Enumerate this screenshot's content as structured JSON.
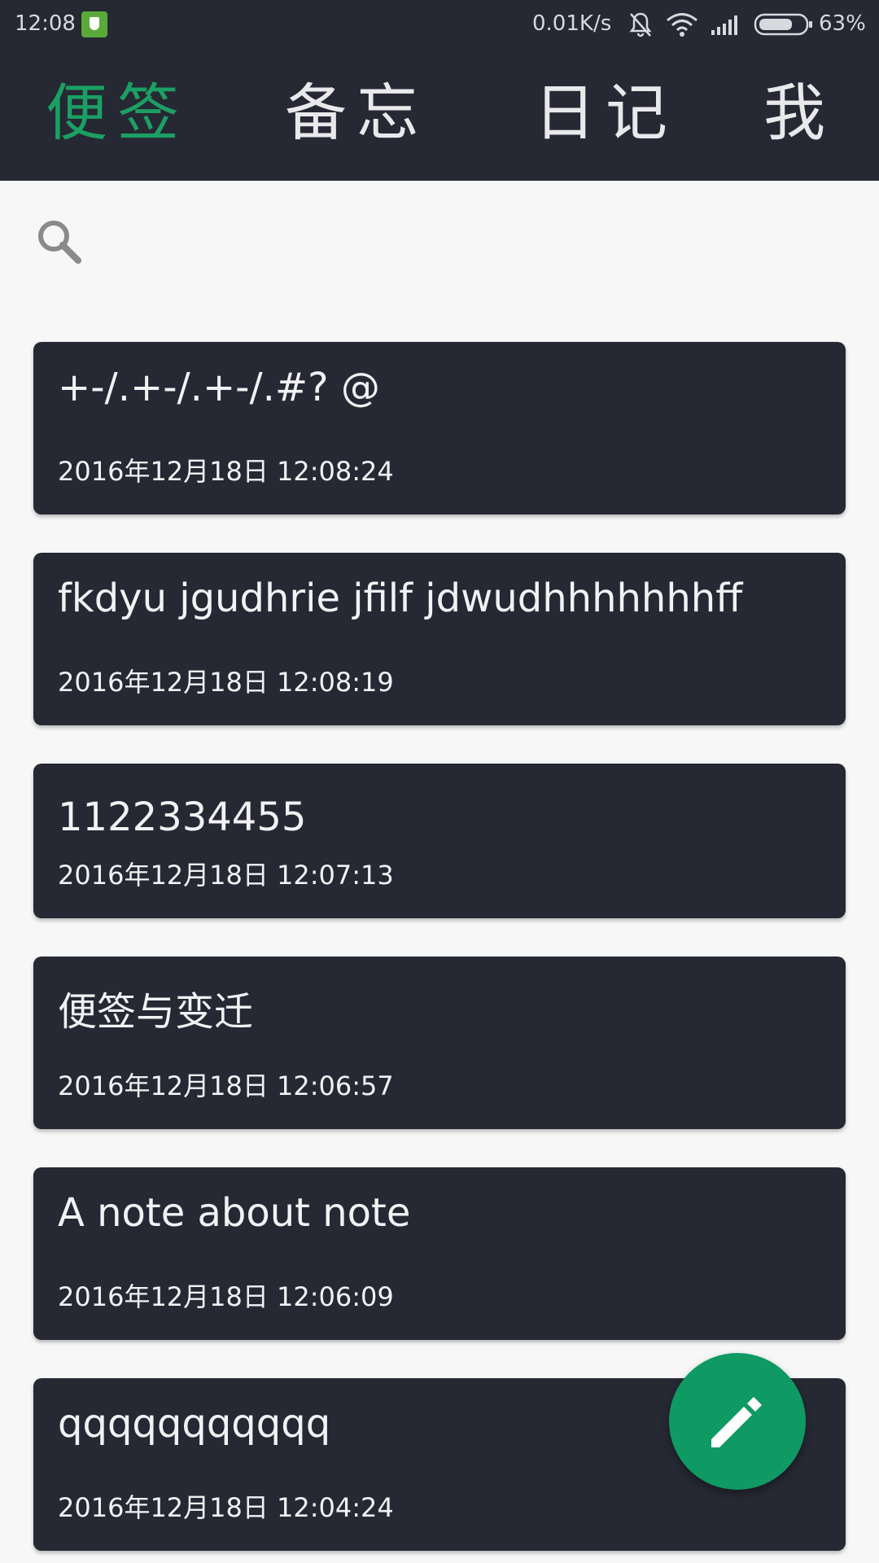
{
  "status_bar": {
    "time": "12:08",
    "network_speed": "0.01K/s",
    "battery_percent": "63%",
    "icons": [
      "shield-app-icon",
      "mute-bell-icon",
      "wifi-icon",
      "signal-icon",
      "battery-icon"
    ]
  },
  "nav": {
    "tabs": [
      {
        "label": "便签",
        "active": true
      },
      {
        "label": "备忘",
        "active": false
      },
      {
        "label": "日记",
        "active": false
      },
      {
        "label": "我",
        "active": false
      }
    ]
  },
  "search": {
    "icon": "search-icon"
  },
  "notes": [
    {
      "title": "+-/.+-/.+-/.#? @",
      "date": "2016年12月18日 12:08:24"
    },
    {
      "title": "fkdyu jgudhrie jfilf jdwudhhhhhhhff",
      "date": "2016年12月18日 12:08:19"
    },
    {
      "title": "1122334455",
      "date": "2016年12月18日 12:07:13"
    },
    {
      "title": "便签与变迁",
      "date": "2016年12月18日 12:06:57"
    },
    {
      "title": "A note about note",
      "date": "2016年12月18日 12:06:09"
    },
    {
      "title": "qqqqqqqqqqq",
      "date": "2016年12月18日 12:04:24"
    }
  ],
  "fab": {
    "icon": "pencil-icon"
  },
  "colors": {
    "bar_bg": "#262833",
    "accent": "#1b9f63",
    "fab": "#0f9a63",
    "page_bg": "#f7f7f7"
  }
}
